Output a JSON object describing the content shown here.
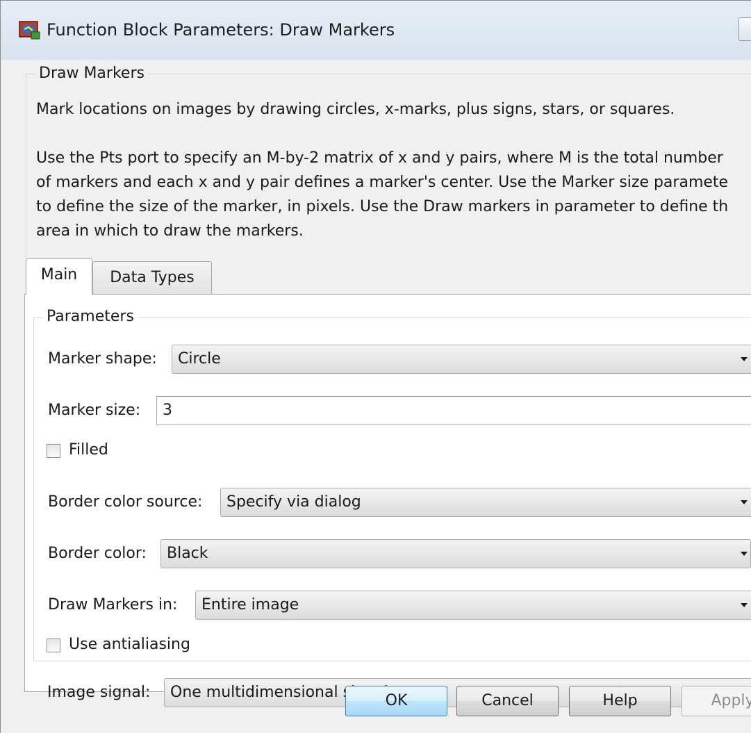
{
  "window": {
    "title": "Function Block Parameters: Draw Markers",
    "icon": "simulink-block-icon"
  },
  "description": {
    "group_title": "Draw Markers",
    "line1": "Mark locations on images by drawing circles, x-marks, plus signs, stars, or squares.",
    "line2": "Use the Pts port to specify an M-by-2 matrix of x and y pairs, where M is the total number",
    "line3": "of markers and each x and y pair defines a marker's center. Use the Marker size paramete",
    "line4": "to define the size of the marker, in pixels. Use the Draw markers in parameter to define th",
    "line5": "area in which to draw the markers."
  },
  "tabs": [
    {
      "label": "Main",
      "active": true
    },
    {
      "label": "Data Types",
      "active": false
    }
  ],
  "parameters": {
    "group_title": "Parameters",
    "marker_shape": {
      "label": "Marker shape:",
      "value": "Circle"
    },
    "marker_size": {
      "label": "Marker size:",
      "value": "3"
    },
    "filled": {
      "label": "Filled",
      "checked": false
    },
    "border_color_source": {
      "label": "Border color source:",
      "value": "Specify via dialog"
    },
    "border_color": {
      "label": "Border color:",
      "value": "Black"
    },
    "draw_markers_in": {
      "label": "Draw Markers in:",
      "value": "Entire image"
    },
    "use_antialiasing": {
      "label": "Use antialiasing",
      "checked": false
    },
    "image_signal": {
      "label": "Image signal:",
      "value": "One multidimensional signal"
    }
  },
  "buttons": {
    "ok": "OK",
    "cancel": "Cancel",
    "help": "Help",
    "apply": "Apply"
  },
  "colors": {
    "dialog_bg": "#f0f0f0",
    "panel_bg": "#ffffff",
    "default_button": "#bee6fd"
  }
}
